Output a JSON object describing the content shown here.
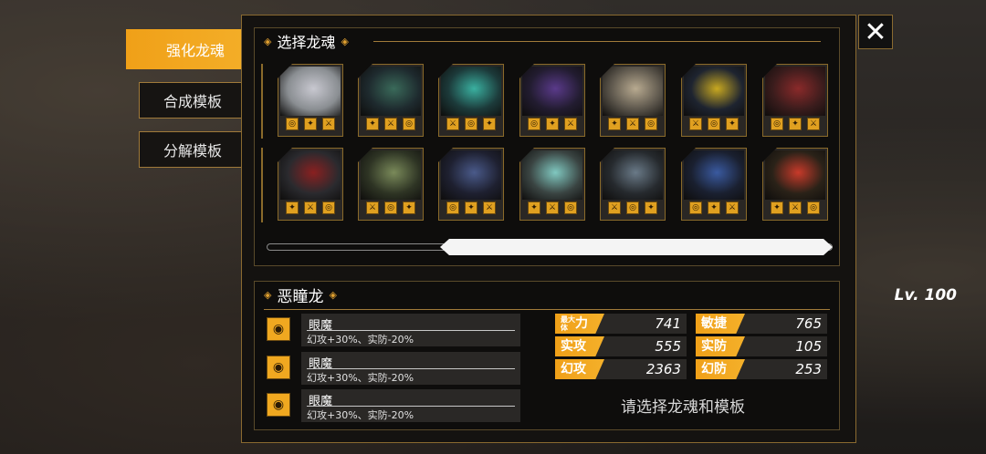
{
  "tabs": [
    {
      "label": "强化龙魂",
      "active": true
    },
    {
      "label": "合成模板",
      "active": false
    },
    {
      "label": "分解模板",
      "active": false
    }
  ],
  "select_section": {
    "title": "选择龙魂"
  },
  "dragons_row1": [
    {
      "color": "#8a8e92",
      "accent": "#c8c8d0"
    },
    {
      "color": "#1e2a2e",
      "accent": "#3a6a5a"
    },
    {
      "color": "#1c3a3a",
      "accent": "#3ab0a0"
    },
    {
      "color": "#221c30",
      "accent": "#5a3a8a"
    },
    {
      "color": "#5a544a",
      "accent": "#b8aa90"
    },
    {
      "color": "#1e2430",
      "accent": "#c8a820"
    },
    {
      "color": "#3a1c1c",
      "accent": "#8a2a2a"
    }
  ],
  "dragons_row2": [
    {
      "color": "#2a2a2e",
      "accent": "#8a2020"
    },
    {
      "color": "#2e3424",
      "accent": "#7a8a5a"
    },
    {
      "color": "#1e2030",
      "accent": "#4a5a8a"
    },
    {
      "color": "#3a4442",
      "accent": "#80c8c0"
    },
    {
      "color": "#262a2e",
      "accent": "#6a7a88"
    },
    {
      "color": "#1a2030",
      "accent": "#3a5aa0"
    },
    {
      "color": "#2a2218",
      "accent": "#c83a2a"
    }
  ],
  "info": {
    "name": "恶瞳龙",
    "level": "Lv. 100",
    "skills": [
      {
        "name": "眼魔",
        "desc": "幻攻+30%、实防-20%"
      },
      {
        "name": "眼魔",
        "desc": "幻攻+30%、实防-20%"
      },
      {
        "name": "眼魔",
        "desc": "幻攻+30%、实防-20%"
      }
    ],
    "stats": [
      {
        "label": "力",
        "prefix": "最大\n体",
        "value": "741"
      },
      {
        "label": "敏捷",
        "value": "765"
      },
      {
        "label": "实攻",
        "value": "555"
      },
      {
        "label": "实防",
        "value": "105"
      },
      {
        "label": "幻攻",
        "value": "2363"
      },
      {
        "label": "幻防",
        "value": "253"
      }
    ],
    "hint": "请选择龙魂和模板"
  },
  "close_icon": "close-icon"
}
